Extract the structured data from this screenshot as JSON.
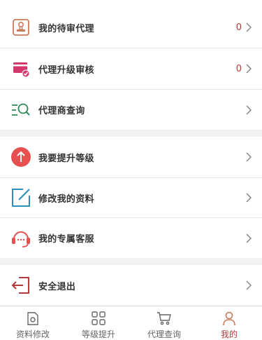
{
  "menu": {
    "items": [
      {
        "label": "我的待审代理",
        "count": "0",
        "icon": "stamp-icon"
      },
      {
        "label": "代理升级审核",
        "count": "0",
        "icon": "card-check-icon"
      },
      {
        "label": "代理商查询",
        "icon": "list-search-icon"
      },
      {
        "label": "我要提升等级",
        "icon": "arrow-up-circle-icon"
      },
      {
        "label": "修改我的资料",
        "icon": "edit-square-icon"
      },
      {
        "label": "我的专属客服",
        "icon": "headset-icon"
      },
      {
        "label": "安全退出",
        "icon": "logout-icon"
      }
    ]
  },
  "tabs": [
    {
      "label": "资料修改",
      "icon": "camera-doc-icon",
      "active": false
    },
    {
      "label": "等级提升",
      "icon": "grid-icon",
      "active": false
    },
    {
      "label": "代理查询",
      "icon": "cart-icon",
      "active": false
    },
    {
      "label": "我的",
      "icon": "user-icon",
      "active": true
    }
  ],
  "colors": {
    "accent": "#b53a3a",
    "pink": "#d6386e",
    "green": "#2e8b57",
    "blue": "#2a8fc0",
    "red_circle": "#e8504f",
    "tan": "#c97a5a"
  }
}
